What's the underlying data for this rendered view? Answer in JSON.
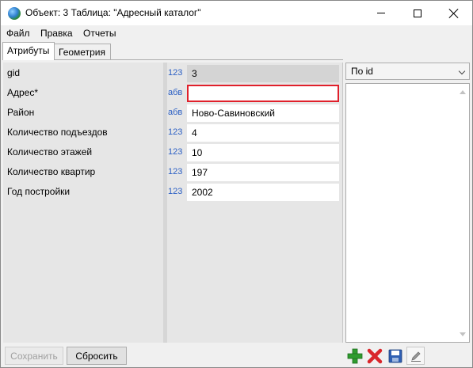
{
  "window": {
    "title": "Объект: 3 Таблица: \"Адресный каталог\"",
    "icon": "globe-icon"
  },
  "menu": {
    "items": [
      {
        "label": "Файл"
      },
      {
        "label": "Правка"
      },
      {
        "label": "Отчеты"
      }
    ]
  },
  "tabs": [
    {
      "label": "Атрибуты",
      "active": true
    },
    {
      "label": "Геометрия",
      "active": false
    }
  ],
  "attributes": [
    {
      "label": "gid",
      "type": "123",
      "value": "3",
      "readonly": true,
      "error": false
    },
    {
      "label": "Адрес*",
      "type": "абв",
      "value": "",
      "readonly": false,
      "error": true
    },
    {
      "label": "Район",
      "type": "абв",
      "value": "Ново-Савиновский",
      "readonly": false,
      "error": false
    },
    {
      "label": "Количество подъездов",
      "type": "123",
      "value": "4",
      "readonly": false,
      "error": false
    },
    {
      "label": "Количество этажей",
      "type": "123",
      "value": "10",
      "readonly": false,
      "error": false
    },
    {
      "label": "Количество квартир",
      "type": "123",
      "value": "197",
      "readonly": false,
      "error": false
    },
    {
      "label": "Год постройки",
      "type": "123",
      "value": "2002",
      "readonly": false,
      "error": false
    }
  ],
  "sort": {
    "selected": "По id"
  },
  "buttons": {
    "save": "Сохранить",
    "reset": "Сбросить"
  },
  "toolbar": {
    "icons": [
      "add-icon",
      "delete-icon",
      "save-disk-icon",
      "edit-icon"
    ]
  },
  "colors": {
    "error_border": "#e0202b",
    "type_badge": "#2b5fc4",
    "add_green": "#2e9b2e",
    "delete_red": "#d9262b"
  }
}
